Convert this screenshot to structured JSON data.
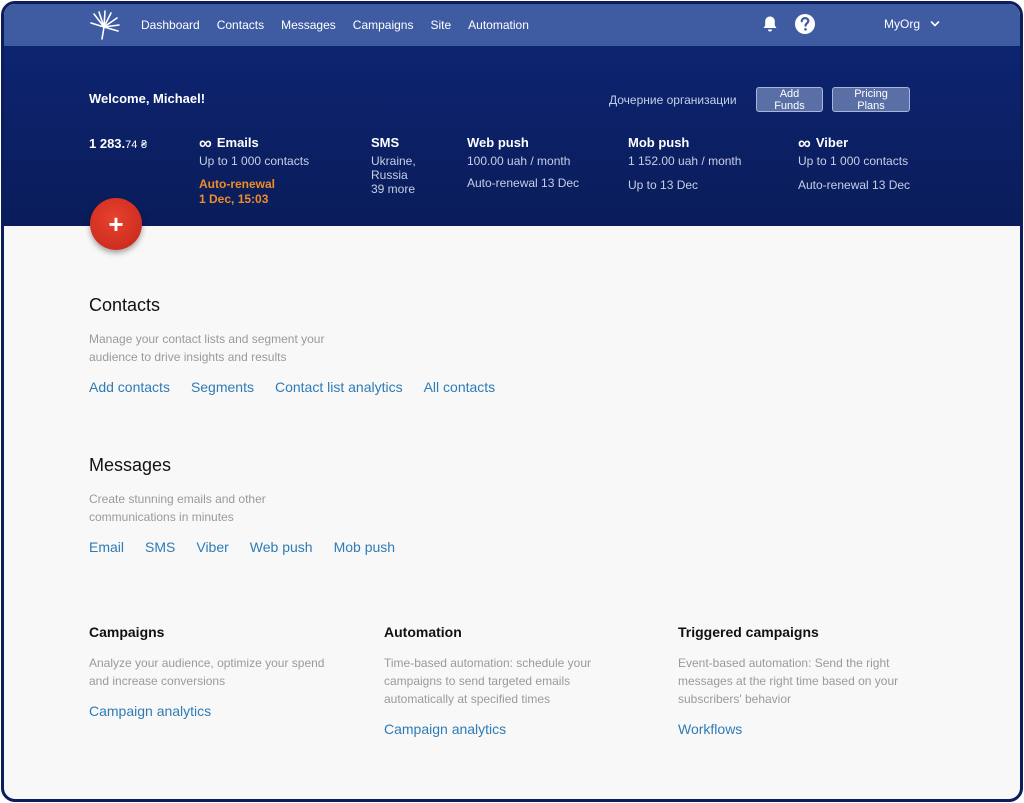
{
  "nav": {
    "links": [
      "Dashboard",
      "Contacts",
      "Messages",
      "Campaigns",
      "Site",
      "Automation"
    ],
    "org": "MyOrg"
  },
  "hero": {
    "welcome": "Welcome, Michael!",
    "subsidiaries": "Дочерние организации",
    "add_funds": "Add Funds",
    "pricing_plans": "Pricing Plans",
    "balance_main": "1 283.",
    "balance_cents": "74",
    "balance_currency": "₴",
    "stats": {
      "emails": {
        "title": "Emails",
        "sub": "Up to 1 000 contacts",
        "renewal": "Auto-renewal",
        "renewal_date": "1 Dec, 15:03"
      },
      "sms": {
        "title": "SMS",
        "line1": "Ukraine,",
        "line2": "Russia",
        "line3": "39 more"
      },
      "webpush": {
        "title": "Web push",
        "sub": "100.00 uah / month",
        "extra": "Auto-renewal 13 Dec"
      },
      "mobpush": {
        "title": "Mob push",
        "sub": "1 152.00 uah / month",
        "extra": "Up to 13 Dec"
      },
      "viber": {
        "title": "Viber",
        "sub": "Up to 1 000 contacts",
        "extra": "Auto-renewal 13 Dec"
      }
    },
    "fab": "+"
  },
  "contacts": {
    "title": "Contacts",
    "desc1": "Manage your contact lists and segment your",
    "desc2": "audience to drive insights and results",
    "links": [
      "Add contacts",
      "Segments",
      "Contact list analytics",
      "All contacts"
    ]
  },
  "messages": {
    "title": "Messages",
    "desc1": "Create stunning emails and other",
    "desc2": "communications in minutes",
    "links": [
      "Email",
      "SMS",
      "Viber",
      "Web push",
      "Mob push"
    ]
  },
  "campaigns": {
    "title": "Campaigns",
    "desc1": "Analyze your audience, optimize your spend",
    "desc2": "and increase conversions",
    "link": "Campaign analytics"
  },
  "automation": {
    "title": "Automation",
    "desc1": "Time-based automation: schedule your",
    "desc2": "campaigns to send targeted emails",
    "desc3": "automatically at specified times",
    "link": "Campaign analytics"
  },
  "triggered": {
    "title": "Triggered campaigns",
    "desc1": "Event-based automation: Send the right",
    "desc2": "messages at the right time based on your",
    "desc3": "subscribers' behavior",
    "link": "Workflows"
  }
}
